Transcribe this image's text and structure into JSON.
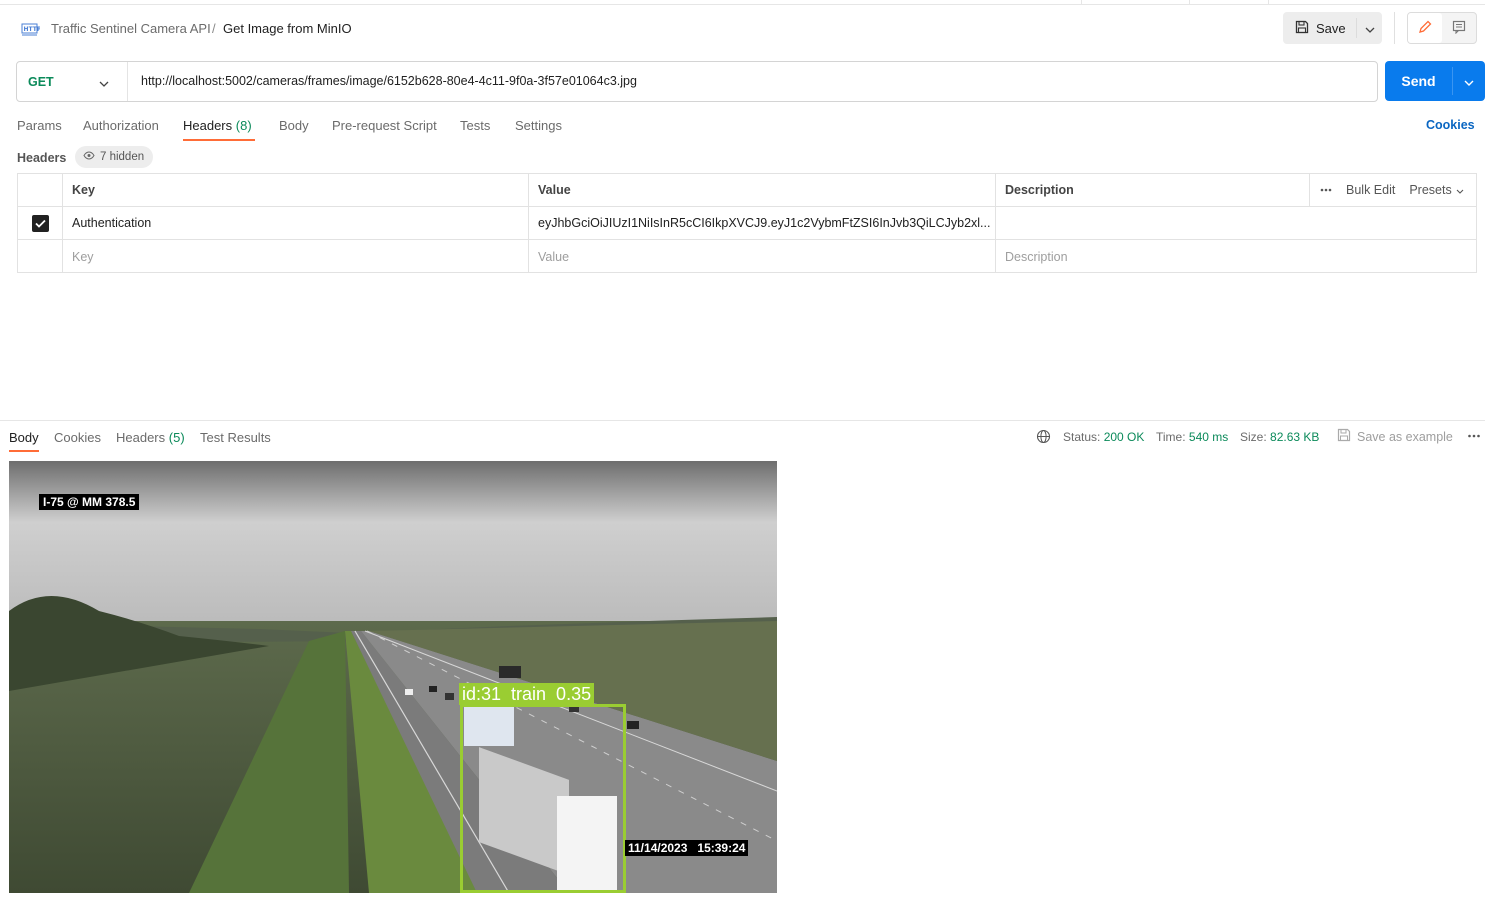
{
  "header": {
    "collection": "Traffic Sentinel Camera API",
    "separator": "/",
    "request_name": "Get Image from MinIO",
    "save_label": "Save"
  },
  "request": {
    "method": "GET",
    "url": "http://localhost:5002/cameras/frames/image/6152b628-80e4-4c11-9f0a-3f57e01064c3.jpg",
    "send_label": "Send"
  },
  "tabs": {
    "params": "Params",
    "authorization": "Authorization",
    "headers": "Headers",
    "headers_count": "(8)",
    "body": "Body",
    "pre_request": "Pre-request Script",
    "tests": "Tests",
    "settings": "Settings",
    "cookies": "Cookies"
  },
  "headers_section": {
    "label": "Headers",
    "hidden": "7 hidden",
    "columns": {
      "key": "Key",
      "value": "Value",
      "description": "Description"
    },
    "bulk_edit": "Bulk Edit",
    "presets": "Presets",
    "rows": [
      {
        "key": "Authentication",
        "value": "eyJhbGciOiJIUzI1NiIsInR5cCI6IkpXVCJ9.eyJ1c2VybmFtZSI6InJvb3QiLCJyb2xl...",
        "description": ""
      }
    ],
    "placeholders": {
      "key": "Key",
      "value": "Value",
      "description": "Description"
    }
  },
  "response": {
    "tabs": {
      "body": "Body",
      "cookies": "Cookies",
      "headers": "Headers",
      "headers_count": "(5)",
      "test_results": "Test Results"
    },
    "status_label": "Status:",
    "status_value": "200 OK",
    "time_label": "Time:",
    "time_value": "540 ms",
    "size_label": "Size:",
    "size_value": "82.63 KB",
    "save_example": "Save as example"
  },
  "image": {
    "camera_label": "I-75 @ MM 378.5",
    "timestamp": "11/14/2023   15:39:24",
    "detection_label": "id:31  train  0.35"
  },
  "colors": {
    "accent_orange": "#ff6c37",
    "send_blue": "#097bed",
    "method_green": "#0b8a5a",
    "detection_green": "#9acd32"
  }
}
